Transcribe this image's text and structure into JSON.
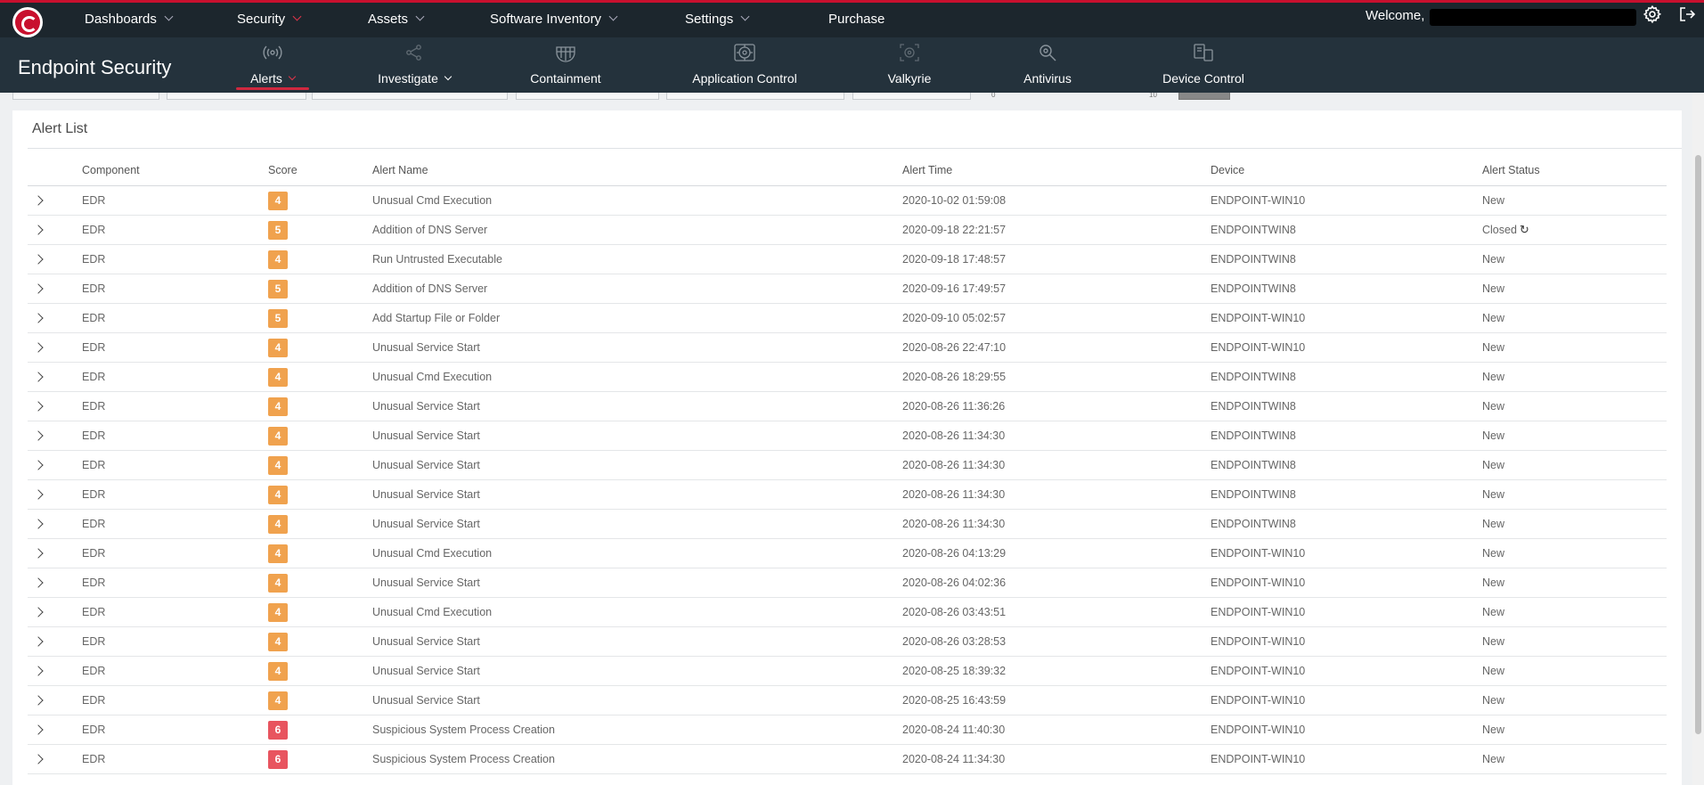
{
  "topnav": {
    "items": [
      {
        "label": "Dashboards",
        "has_menu": true
      },
      {
        "label": "Security",
        "has_menu": true
      },
      {
        "label": "Assets",
        "has_menu": true
      },
      {
        "label": "Software Inventory",
        "has_menu": true
      },
      {
        "label": "Settings",
        "has_menu": true
      },
      {
        "label": "Purchase",
        "has_menu": false
      }
    ],
    "welcome": "Welcome,",
    "username_redacted": true,
    "settings_icon": "gear-icon",
    "logout_icon": "logout-icon",
    "accent_color": "#c8102e"
  },
  "subnav": {
    "title": "Endpoint Security",
    "tabs": [
      {
        "label": "Alerts",
        "icon": "broadcast-icon",
        "active": true,
        "has_menu": true
      },
      {
        "label": "Investigate",
        "icon": "share-network-icon",
        "active": false,
        "has_menu": true
      },
      {
        "label": "Containment",
        "icon": "globe-grid-icon",
        "active": false,
        "has_menu": false
      },
      {
        "label": "Application Control",
        "icon": "app-target-icon",
        "active": false,
        "has_menu": false
      },
      {
        "label": "Valkyrie",
        "icon": "scan-target-icon",
        "active": false,
        "has_menu": false
      },
      {
        "label": "Antivirus",
        "icon": "virus-search-icon",
        "active": false,
        "has_menu": false
      },
      {
        "label": "Device Control",
        "icon": "devices-icon",
        "active": false,
        "has_menu": false
      }
    ]
  },
  "filters": {
    "slider_min": "0",
    "slider_max": "10"
  },
  "alert_list": {
    "title": "Alert List",
    "columns": [
      "Component",
      "Score",
      "Alert Name",
      "Alert Time",
      "Device",
      "Alert Status"
    ],
    "score_colors": {
      "4": "#f0a24e",
      "5": "#f0a24e",
      "6": "#e8545f"
    },
    "rows": [
      {
        "component": "EDR",
        "score": "4",
        "name": "Unusual Cmd Execution",
        "time": "2020-10-02 01:59:08",
        "device": "ENDPOINT-WIN10",
        "status": "New"
      },
      {
        "component": "EDR",
        "score": "5",
        "name": "Addition of DNS Server",
        "time": "2020-09-18 22:21:57",
        "device": "ENDPOINTWIN8",
        "status": "Closed",
        "reopen_icon": true
      },
      {
        "component": "EDR",
        "score": "4",
        "name": "Run Untrusted Executable",
        "time": "2020-09-18 17:48:57",
        "device": "ENDPOINTWIN8",
        "status": "New"
      },
      {
        "component": "EDR",
        "score": "5",
        "name": "Addition of DNS Server",
        "time": "2020-09-16 17:49:57",
        "device": "ENDPOINTWIN8",
        "status": "New"
      },
      {
        "component": "EDR",
        "score": "5",
        "name": "Add Startup File or Folder",
        "time": "2020-09-10 05:02:57",
        "device": "ENDPOINT-WIN10",
        "status": "New"
      },
      {
        "component": "EDR",
        "score": "4",
        "name": "Unusual Service Start",
        "time": "2020-08-26 22:47:10",
        "device": "ENDPOINT-WIN10",
        "status": "New"
      },
      {
        "component": "EDR",
        "score": "4",
        "name": "Unusual Cmd Execution",
        "time": "2020-08-26 18:29:55",
        "device": "ENDPOINTWIN8",
        "status": "New"
      },
      {
        "component": "EDR",
        "score": "4",
        "name": "Unusual Service Start",
        "time": "2020-08-26 11:36:26",
        "device": "ENDPOINTWIN8",
        "status": "New"
      },
      {
        "component": "EDR",
        "score": "4",
        "name": "Unusual Service Start",
        "time": "2020-08-26 11:34:30",
        "device": "ENDPOINTWIN8",
        "status": "New"
      },
      {
        "component": "EDR",
        "score": "4",
        "name": "Unusual Service Start",
        "time": "2020-08-26 11:34:30",
        "device": "ENDPOINTWIN8",
        "status": "New"
      },
      {
        "component": "EDR",
        "score": "4",
        "name": "Unusual Service Start",
        "time": "2020-08-26 11:34:30",
        "device": "ENDPOINTWIN8",
        "status": "New"
      },
      {
        "component": "EDR",
        "score": "4",
        "name": "Unusual Service Start",
        "time": "2020-08-26 11:34:30",
        "device": "ENDPOINTWIN8",
        "status": "New"
      },
      {
        "component": "EDR",
        "score": "4",
        "name": "Unusual Cmd Execution",
        "time": "2020-08-26 04:13:29",
        "device": "ENDPOINT-WIN10",
        "status": "New"
      },
      {
        "component": "EDR",
        "score": "4",
        "name": "Unusual Service Start",
        "time": "2020-08-26 04:02:36",
        "device": "ENDPOINT-WIN10",
        "status": "New"
      },
      {
        "component": "EDR",
        "score": "4",
        "name": "Unusual Cmd Execution",
        "time": "2020-08-26 03:43:51",
        "device": "ENDPOINT-WIN10",
        "status": "New"
      },
      {
        "component": "EDR",
        "score": "4",
        "name": "Unusual Service Start",
        "time": "2020-08-26 03:28:53",
        "device": "ENDPOINT-WIN10",
        "status": "New"
      },
      {
        "component": "EDR",
        "score": "4",
        "name": "Unusual Service Start",
        "time": "2020-08-25 18:39:32",
        "device": "ENDPOINT-WIN10",
        "status": "New"
      },
      {
        "component": "EDR",
        "score": "4",
        "name": "Unusual Service Start",
        "time": "2020-08-25 16:43:59",
        "device": "ENDPOINT-WIN10",
        "status": "New"
      },
      {
        "component": "EDR",
        "score": "6",
        "name": "Suspicious System Process Creation",
        "time": "2020-08-24 11:40:30",
        "device": "ENDPOINT-WIN10",
        "status": "New"
      },
      {
        "component": "EDR",
        "score": "6",
        "name": "Suspicious System Process Creation",
        "time": "2020-08-24 11:34:30",
        "device": "ENDPOINT-WIN10",
        "status": "New"
      }
    ]
  }
}
